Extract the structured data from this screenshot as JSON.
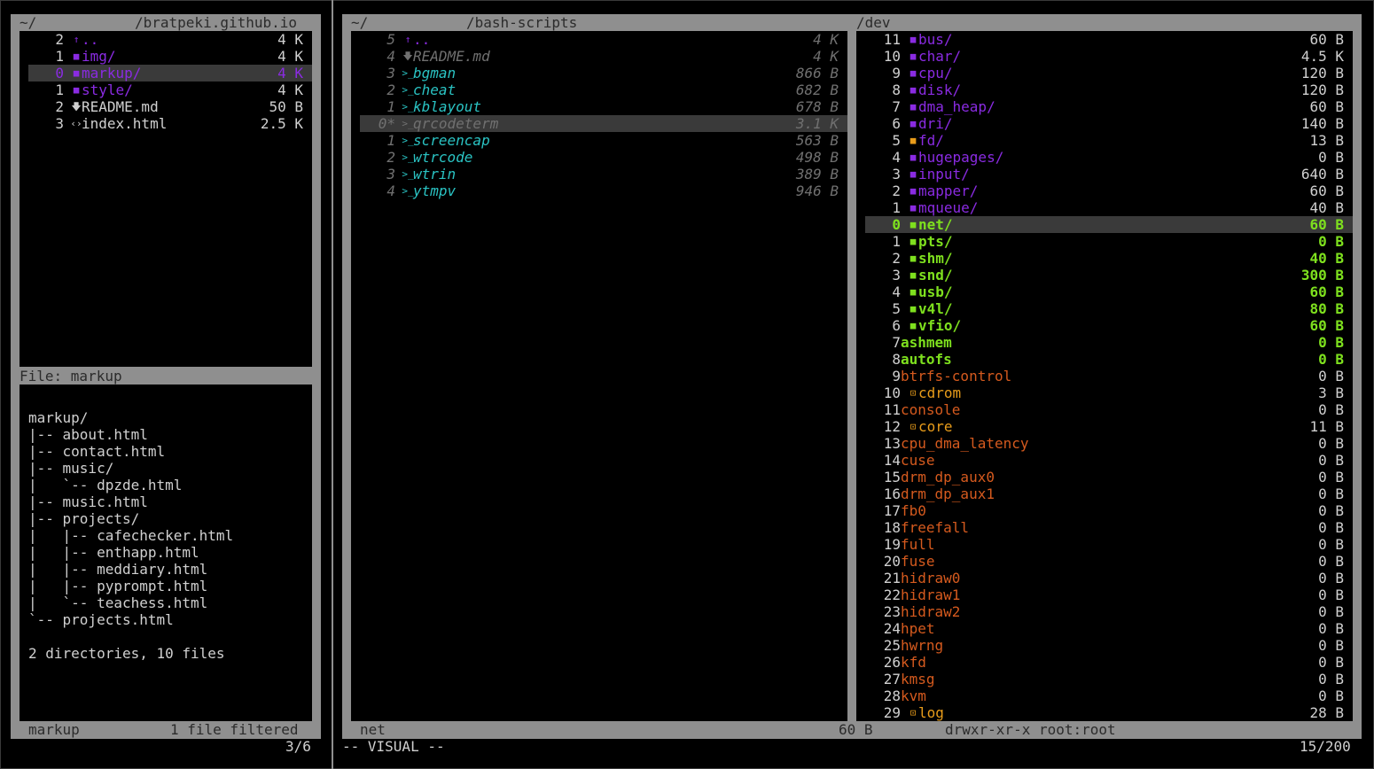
{
  "left": {
    "header": {
      "home": "~/",
      "path": "/bratpeki.github.io"
    },
    "items": [
      {
        "num": "2",
        "icon": "↑",
        "name": "..",
        "size": "4 K",
        "color": "purple"
      },
      {
        "num": "1",
        "icon": "■",
        "name": "img/",
        "size": "4 K",
        "color": "purple"
      },
      {
        "num": "0",
        "icon": "■",
        "name": "markup/",
        "size": "4 K",
        "color": "purple",
        "selected": true
      },
      {
        "num": "1",
        "icon": "■",
        "name": "style/",
        "size": "4 K",
        "color": "purple"
      },
      {
        "num": "2",
        "icon": "🡇",
        "name": "README.md",
        "size": "50 B",
        "color": "white"
      },
      {
        "num": "3",
        "icon": "‹›",
        "name": "index.html",
        "size": "2.5 K",
        "color": "white"
      }
    ],
    "preview_header": "File: markup",
    "tree": [
      "markup/",
      "|-- about.html",
      "|-- contact.html",
      "|-- music/",
      "|   `-- dpzde.html",
      "|-- music.html",
      "|-- projects/",
      "|   |-- cafechecker.html",
      "|   |-- enthapp.html",
      "|   |-- meddiary.html",
      "|   |-- pyprompt.html",
      "|   `-- teachess.html",
      "`-- projects.html",
      "",
      "2 directories, 10 files"
    ],
    "footer_name": "markup",
    "footer_filter": "1 file filtered",
    "position": "3/6"
  },
  "middle": {
    "header": {
      "home": "~/",
      "path": "/bash-scripts"
    },
    "items": [
      {
        "num": "5",
        "icon": "↑",
        "name": "..",
        "size": "4 K",
        "color": "purple"
      },
      {
        "num": "4",
        "icon": "🡇",
        "name": "README.md",
        "size": "4 K",
        "color": "grey-it"
      },
      {
        "num": "3",
        "icon": ">_",
        "name": "bgman",
        "size": "866 B",
        "color": "cyan"
      },
      {
        "num": "2",
        "icon": ">_",
        "name": "cheat",
        "size": "682 B",
        "color": "cyan"
      },
      {
        "num": "1",
        "icon": ">_",
        "name": "kblayout",
        "size": "678 B",
        "color": "cyan"
      },
      {
        "num": "0*",
        "icon": ">_",
        "name": "qrcodeterm",
        "size": "3.1 K",
        "color": "grey-it",
        "selected": true
      },
      {
        "num": "1",
        "icon": ">_",
        "name": "screencap",
        "size": "563 B",
        "color": "cyan"
      },
      {
        "num": "2",
        "icon": ">_",
        "name": "wtrcode",
        "size": "498 B",
        "color": "cyan"
      },
      {
        "num": "3",
        "icon": ">_",
        "name": "wtrin",
        "size": "389 B",
        "color": "cyan"
      },
      {
        "num": "4",
        "icon": ">_",
        "name": "ytmpv",
        "size": "946 B",
        "color": "cyan"
      }
    ],
    "footer_name": "net",
    "footer_size": "60 B",
    "footer_perm": "drwxr-xr-x root:root",
    "mode": "-- VISUAL --"
  },
  "right": {
    "header": {
      "path": "/dev"
    },
    "items": [
      {
        "num": "11",
        "icon": "■",
        "name": "bus/",
        "size": "60 B",
        "color": "purple"
      },
      {
        "num": "10",
        "icon": "■",
        "name": "char/",
        "size": "4.5 K",
        "color": "purple"
      },
      {
        "num": "9",
        "icon": "■",
        "name": "cpu/",
        "size": "120 B",
        "color": "purple"
      },
      {
        "num": "8",
        "icon": "■",
        "name": "disk/",
        "size": "120 B",
        "color": "purple"
      },
      {
        "num": "7",
        "icon": "■",
        "name": "dma_heap/",
        "size": "60 B",
        "color": "purple"
      },
      {
        "num": "6",
        "icon": "■",
        "name": "dri/",
        "size": "140 B",
        "color": "purple"
      },
      {
        "num": "5",
        "icon": "■",
        "name": "fd/",
        "size": "13 B",
        "color": "purple",
        "icon_color": "yellow"
      },
      {
        "num": "4",
        "icon": "■",
        "name": "hugepages/",
        "size": "0 B",
        "color": "purple"
      },
      {
        "num": "3",
        "icon": "■",
        "name": "input/",
        "size": "640 B",
        "color": "purple"
      },
      {
        "num": "2",
        "icon": "■",
        "name": "mapper/",
        "size": "60 B",
        "color": "purple"
      },
      {
        "num": "1",
        "icon": "■",
        "name": "mqueue/",
        "size": "40 B",
        "color": "purple"
      },
      {
        "num": "0",
        "icon": "■",
        "name": "net/",
        "size": "60 B",
        "color": "green",
        "selected": true
      },
      {
        "num": "1",
        "icon": "■",
        "name": "pts/",
        "size": "0 B",
        "color": "green"
      },
      {
        "num": "2",
        "icon": "■",
        "name": "shm/",
        "size": "40 B",
        "color": "green"
      },
      {
        "num": "3",
        "icon": "■",
        "name": "snd/",
        "size": "300 B",
        "color": "green"
      },
      {
        "num": "4",
        "icon": "■",
        "name": "usb/",
        "size": "60 B",
        "color": "green"
      },
      {
        "num": "5",
        "icon": "■",
        "name": "v4l/",
        "size": "80 B",
        "color": "green"
      },
      {
        "num": "6",
        "icon": "■",
        "name": "vfio/",
        "size": "60 B",
        "color": "green"
      },
      {
        "num": "7",
        "icon": "",
        "name": "ashmem",
        "size": "0 B",
        "color": "green"
      },
      {
        "num": "8",
        "icon": "",
        "name": "autofs",
        "size": "0 B",
        "color": "green"
      },
      {
        "num": "9",
        "icon": "",
        "name": "btrfs-control",
        "size": "0 B",
        "color": "orange"
      },
      {
        "num": "10",
        "icon": "⊡",
        "name": "cdrom",
        "size": "3 B",
        "color": "yellow"
      },
      {
        "num": "11",
        "icon": "",
        "name": "console",
        "size": "0 B",
        "color": "orange"
      },
      {
        "num": "12",
        "icon": "⊡",
        "name": "core",
        "size": "11 B",
        "color": "yellow"
      },
      {
        "num": "13",
        "icon": "",
        "name": "cpu_dma_latency",
        "size": "0 B",
        "color": "orange"
      },
      {
        "num": "14",
        "icon": "",
        "name": "cuse",
        "size": "0 B",
        "color": "orange"
      },
      {
        "num": "15",
        "icon": "",
        "name": "drm_dp_aux0",
        "size": "0 B",
        "color": "orange"
      },
      {
        "num": "16",
        "icon": "",
        "name": "drm_dp_aux1",
        "size": "0 B",
        "color": "orange"
      },
      {
        "num": "17",
        "icon": "",
        "name": "fb0",
        "size": "0 B",
        "color": "orange"
      },
      {
        "num": "18",
        "icon": "",
        "name": "freefall",
        "size": "0 B",
        "color": "orange"
      },
      {
        "num": "19",
        "icon": "",
        "name": "full",
        "size": "0 B",
        "color": "orange"
      },
      {
        "num": "20",
        "icon": "",
        "name": "fuse",
        "size": "0 B",
        "color": "orange"
      },
      {
        "num": "21",
        "icon": "",
        "name": "hidraw0",
        "size": "0 B",
        "color": "orange"
      },
      {
        "num": "22",
        "icon": "",
        "name": "hidraw1",
        "size": "0 B",
        "color": "orange"
      },
      {
        "num": "23",
        "icon": "",
        "name": "hidraw2",
        "size": "0 B",
        "color": "orange"
      },
      {
        "num": "24",
        "icon": "",
        "name": "hpet",
        "size": "0 B",
        "color": "orange"
      },
      {
        "num": "25",
        "icon": "",
        "name": "hwrng",
        "size": "0 B",
        "color": "orange"
      },
      {
        "num": "26",
        "icon": "",
        "name": "kfd",
        "size": "0 B",
        "color": "orange"
      },
      {
        "num": "27",
        "icon": "",
        "name": "kmsg",
        "size": "0 B",
        "color": "orange"
      },
      {
        "num": "28",
        "icon": "",
        "name": "kvm",
        "size": "0 B",
        "color": "orange"
      },
      {
        "num": "29",
        "icon": "⊡",
        "name": "log",
        "size": "28 B",
        "color": "yellow"
      }
    ],
    "position": "15/200"
  },
  "colors": {
    "purple": "#8a2be2",
    "cyan": "#2ac3c3",
    "green": "#7ee01e",
    "orange": "#d55a1e",
    "yellow": "#e89c1a",
    "frame": "#8f8f8f",
    "selection": "#3a3a3a"
  }
}
